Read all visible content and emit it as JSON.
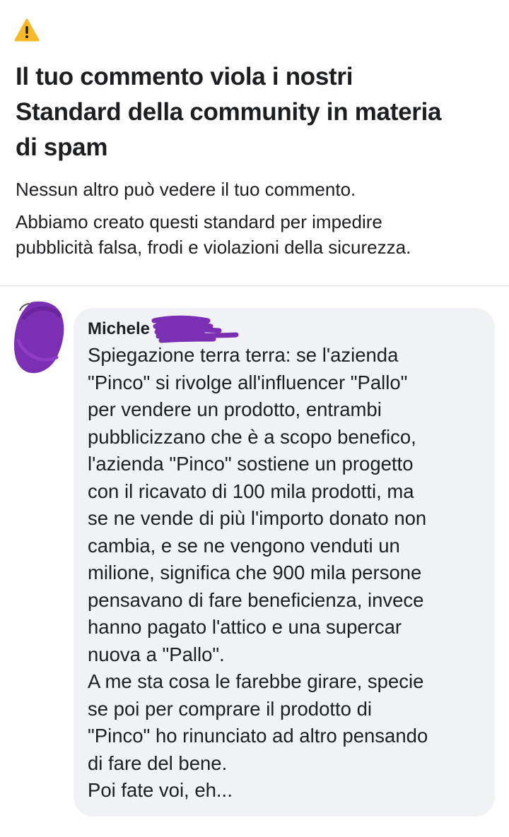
{
  "notice": {
    "icon": "warning-icon",
    "title": "Il tuo commento viola i nostri Standard della community in materia di spam",
    "title_lines": [
      "Il tuo commento viola i nostri",
      "Standard della community in materia",
      "di spam"
    ],
    "line1": "Nessun altro può vedere il tuo commento.",
    "line2_lines": [
      "Abbiamo creato questi standard per impedire",
      "pubblicità falsa, frodi e violazioni della sicurezza."
    ]
  },
  "comment": {
    "author": "Michele",
    "avatar_icon": "redacted-avatar",
    "lines": [
      "Spiegazione terra terra: se l'azienda",
      "\"Pinco\" si rivolge all'influencer \"Pallo\"",
      "per vendere un prodotto, entrambi",
      "pubblicizzano che è a scopo benefico,",
      "l'azienda \"Pinco\" sostiene un progetto",
      "con il ricavato di 100 mila prodotti, ma",
      "se ne vende di più l'importo donato non",
      "cambia, e se ne vengono venduti un",
      "milione, significa che 900 mila persone",
      "pensavano di fare beneficienza, invece",
      "hanno pagato l'attico e una supercar",
      "nuova a \"Pallo\".",
      "A me sta cosa le farebbe girare, specie",
      "se poi per comprare il prodotto di",
      "\"Pinco\" ho rinunciato ad altro pensando",
      "di fare del bene.",
      "Poi fate voi, eh..."
    ]
  },
  "colors": {
    "warning_yellow": "#f7b928",
    "bubble_bg": "#f0f2f5",
    "text": "#1c1e21",
    "redaction_purple": "#7b2fb3"
  }
}
